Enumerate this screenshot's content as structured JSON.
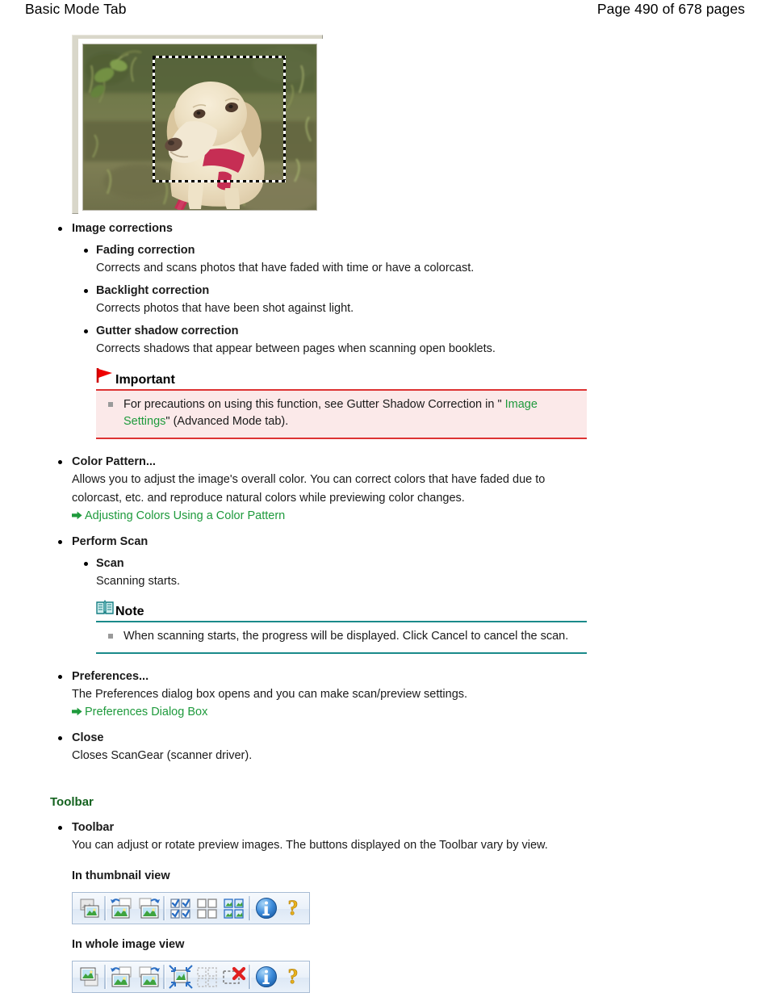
{
  "header": {
    "title": "Basic Mode Tab",
    "page_info": "Page 490 of 678 pages"
  },
  "figure": {
    "caption": "ScanGear preview thumbnail of a yellow Labrador dog on grass with a dashed crop selection frame",
    "alt_icon": "preview-photo-dog"
  },
  "sections": {
    "image_corrections": {
      "term": "Image corrections",
      "items": [
        {
          "term": "Fading correction",
          "desc": "Corrects and scans photos that have faded with time or have a colorcast."
        },
        {
          "term": "Backlight correction",
          "desc": "Corrects photos that have been shot against light."
        },
        {
          "term": "Gutter shadow correction",
          "desc": "Corrects shadows that appear between pages when scanning open booklets."
        }
      ],
      "important": {
        "label": "Important",
        "icon": "red-flag-icon",
        "text_before": "For precautions on using this function, see Gutter Shadow Correction in \"",
        "link": "Image Settings",
        "text_after": "\" (Advanced Mode tab)."
      }
    },
    "color_pattern": {
      "term": "Color Pattern...",
      "desc": "Allows you to adjust the image's overall color. You can correct colors that have faded due to colorcast, etc. and reproduce natural colors while previewing color changes.",
      "link": "Adjusting Colors Using a Color Pattern"
    },
    "perform_scan": {
      "term": "Perform Scan",
      "items": [
        {
          "term": "Scan",
          "desc": "Scanning starts."
        }
      ],
      "note": {
        "label": "Note",
        "icon": "book-note-icon",
        "text": "When scanning starts, the progress will be displayed. Click Cancel to cancel the scan."
      }
    },
    "preferences": {
      "term": "Preferences...",
      "desc": "The Preferences dialog box opens and you can make scan/preview settings.",
      "link": "Preferences Dialog Box"
    },
    "close": {
      "term": "Close",
      "desc": "Closes ScanGear (scanner driver)."
    },
    "toolbar": {
      "heading": "Toolbar",
      "term": "Toolbar",
      "desc": "You can adjust or rotate preview images. The buttons displayed on the Toolbar vary by view.",
      "thumbnail_view_label": "In thumbnail view",
      "whole_image_view_label": "In whole image view",
      "thumbnail_buttons": [
        {
          "name": "preview-icon",
          "tip": "Preview"
        },
        {
          "name": "rotate-left-icon",
          "tip": "Rotate Left"
        },
        {
          "name": "rotate-right-icon",
          "tip": "Rotate Right"
        },
        {
          "name": "select-all-frames-icon",
          "tip": "Select All Frames"
        },
        {
          "name": "deselect-all-frames-icon",
          "tip": "Clear All Frames"
        },
        {
          "name": "auto-crop-frames-icon",
          "tip": "Auto Crop"
        },
        {
          "name": "information-icon",
          "tip": "Information"
        },
        {
          "name": "help-icon",
          "tip": "Help"
        }
      ],
      "whole_image_buttons": [
        {
          "name": "preview-icon",
          "tip": "Preview"
        },
        {
          "name": "rotate-left-icon",
          "tip": "Rotate Left"
        },
        {
          "name": "rotate-right-icon",
          "tip": "Rotate Right"
        },
        {
          "name": "auto-crop-icon",
          "tip": "Auto Crop"
        },
        {
          "name": "select-all-frames-disabled-icon",
          "tip": "Select All Frames"
        },
        {
          "name": "remove-frame-icon",
          "tip": "Remove Frame"
        },
        {
          "name": "information-icon",
          "tip": "Information"
        },
        {
          "name": "help-icon",
          "tip": "Help"
        }
      ]
    }
  },
  "colors": {
    "link_green": "#1e9a3c",
    "heading_green": "#14621f",
    "important_red": "#dd3333",
    "important_bg": "#fbe9e9",
    "note_teal": "#1a8a8a",
    "text": "#1a1a1a"
  }
}
